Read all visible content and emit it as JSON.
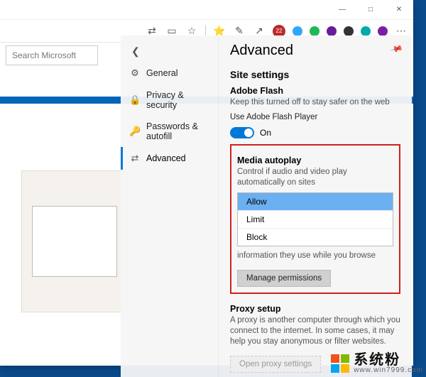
{
  "window_controls": {
    "min": "—",
    "max": "□",
    "close": "✕"
  },
  "toolbar_icons": {
    "translate": "⇄",
    "library": "▭",
    "star": "☆",
    "star_add": "⭐",
    "sign": "✎",
    "share": "↗",
    "abp_badge_bg": "#bb2b2b",
    "abp_badge_text": "22",
    "dot1": "#2fa7ff",
    "dot2": "#1db954",
    "dot3": "#6a1b9a",
    "dot4": "#333",
    "dot5": "#0aa",
    "dot6": "#7b1fa2",
    "more": "⋯"
  },
  "search_placeholder": "Search Microsoft",
  "settings": {
    "title": "Advanced",
    "nav": {
      "back": "❮",
      "items": [
        {
          "icon": "⚙",
          "label": "General"
        },
        {
          "icon": "🔒",
          "label": "Privacy & security"
        },
        {
          "icon": "🔑",
          "label": "Passwords & autofill"
        },
        {
          "icon": "⇄",
          "label": "Advanced"
        }
      ],
      "active_index": 3
    },
    "site_settings_heading": "Site settings",
    "flash": {
      "heading": "Adobe Flash",
      "desc": "Keep this turned off to stay safer on the web",
      "toggle_label": "Use Adobe Flash Player",
      "state_text": "On"
    },
    "autoplay": {
      "heading": "Media autoplay",
      "desc": "Control if audio and video play automatically on sites",
      "options": [
        "Allow",
        "Limit",
        "Block"
      ],
      "selected_index": 0
    },
    "permissions": {
      "partial_desc": "information they use while you browse",
      "button": "Manage permissions"
    },
    "proxy": {
      "heading": "Proxy setup",
      "desc": "A proxy is another computer through which you connect to the internet. In some cases, it may help you stay anonymous or filter websites.",
      "button": "Open proxy settings"
    }
  },
  "brand": {
    "chinese": "系统粉",
    "url": "www.win7999.com"
  },
  "ms_colors": {
    "a": "#f25022",
    "b": "#7fba00",
    "c": "#00a4ef",
    "d": "#ffb900"
  }
}
